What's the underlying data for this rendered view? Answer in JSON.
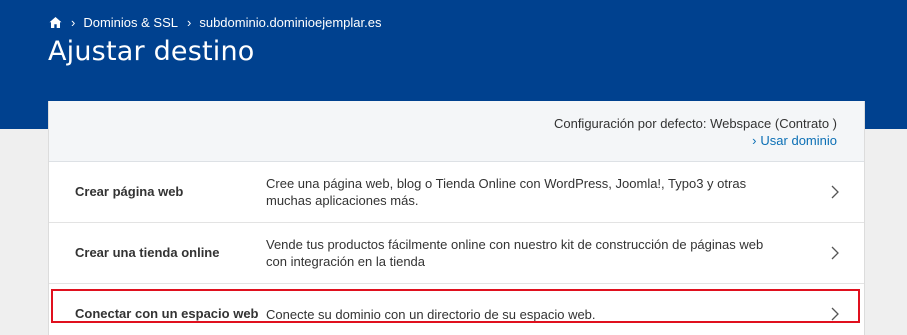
{
  "breadcrumb": {
    "items": [
      "Dominios & SSL",
      "subdominio.dominioejemplar.es"
    ]
  },
  "page": {
    "title": "Ajustar destino"
  },
  "config": {
    "default_text": "Configuración por defecto: Webspace (Contrato )",
    "use_domain_link": "Usar dominio"
  },
  "options": [
    {
      "title": "Crear página web",
      "description": "Cree una página web, blog o Tienda Online con WordPress, Joomla!, Typo3 y otras muchas aplicaciones más."
    },
    {
      "title": "Crear una tienda online",
      "description": "Vende tus productos fácilmente online con nuestro kit de construcción de páginas web con integración en la tienda"
    },
    {
      "title": "Conectar con un espacio web",
      "description": "Conecte su dominio con un directorio de su espacio web."
    }
  ],
  "colors": {
    "header": "#00418f",
    "link": "#0b6fb5",
    "highlight": "#e0101e"
  }
}
